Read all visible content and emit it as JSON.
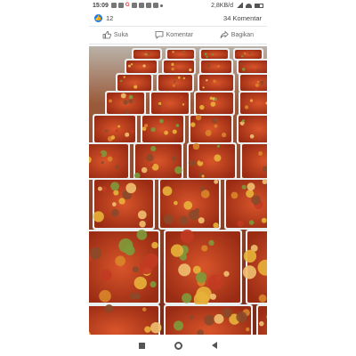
{
  "status_bar": {
    "time": "15:09",
    "network_speed": "2,8KB/d",
    "icons": [
      "whatsapp-icon",
      "message-icon",
      "google-icon",
      "notification-icon",
      "mail-icon",
      "youtube-icon",
      "shopee-icon",
      "dot-icon"
    ],
    "google_letter": "G"
  },
  "post": {
    "reaction_count": "12",
    "comment_count": "34 Komentar",
    "like_badge_glyph": "👍"
  },
  "actions": {
    "like_label": "Suka",
    "comment_label": "Komentar",
    "share_label": "Bagikan"
  },
  "photo": {
    "subject": "food-containers-photo"
  },
  "navbar": {
    "buttons": [
      "recents-button",
      "home-button",
      "back-button"
    ]
  }
}
